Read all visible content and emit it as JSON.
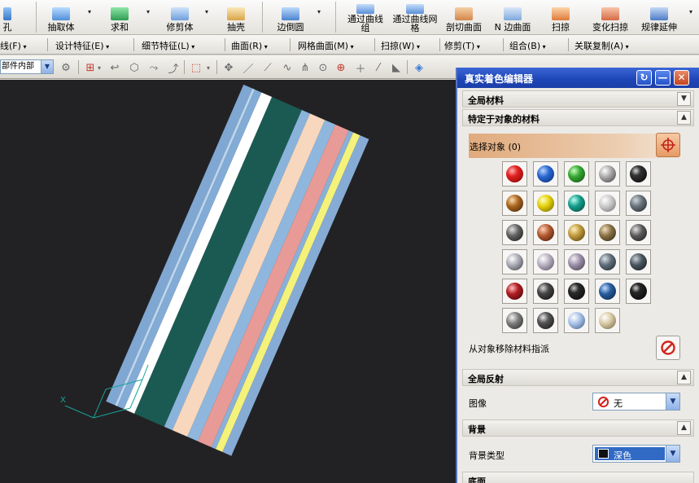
{
  "ribbon": {
    "items": [
      "孔",
      "抽取体",
      "求和",
      "修剪体",
      "抽壳",
      "边倒圆",
      "通过曲线组",
      "通过曲线网格",
      "剖切曲面",
      "N 边曲面",
      "扫掠",
      "变化扫掠",
      "规律延伸"
    ]
  },
  "menubar": {
    "items": [
      "线(F)",
      "设计特征(E)",
      "细节特征(L)",
      "曲面(R)",
      "网格曲面(M)",
      "扫掠(W)",
      "修剪(T)",
      "组合(B)",
      "关联复制(A)"
    ]
  },
  "selection_filter": {
    "value": "部件内部"
  },
  "dialog": {
    "title": "真实着色编辑器",
    "section_global_material": "全局材料",
    "section_object_material": "特定于对象的材料",
    "select_object_label": "选择对象 (0)",
    "remove_assign_label": "从对象移除材料指派",
    "section_global_reflection": "全局反射",
    "image_label": "图像",
    "image_value": "无",
    "section_background": "背景",
    "background_type_label": "背景类型",
    "background_type_value": "深色",
    "section_floor": "底面"
  },
  "colors": {
    "viewport_background": "#222224",
    "titlebar": "#2450c4",
    "select_bar": "#e8b48a"
  },
  "materials": {
    "rows": [
      [
        "red",
        "blue",
        "green",
        "silver",
        "black"
      ],
      [
        "bronze",
        "yellow",
        "teal",
        "light-gray",
        "dark-gray"
      ],
      [
        "graphite",
        "copper",
        "gold",
        "brass",
        "gunmetal"
      ],
      [
        "chrome",
        "pearl",
        "lavender-gray",
        "slate",
        "charcoal"
      ],
      [
        "ruby",
        "dark-steel",
        "obsidian",
        "navy",
        "jet"
      ],
      [
        "steel",
        "dark-chrome",
        "glass",
        "ivory"
      ]
    ]
  }
}
